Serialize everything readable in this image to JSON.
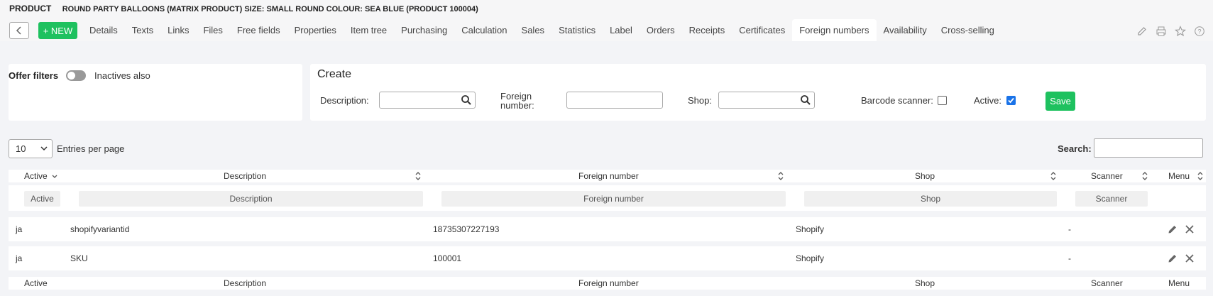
{
  "header": {
    "label": "PRODUCT",
    "product_name": "ROUND PARTY BALLOONS (MATRIX PRODUCT) SIZE: SMALL ROUND COLOUR: SEA BLUE (PRODUCT 100004)"
  },
  "toolbar": {
    "new_label": "+ NEW",
    "tabs": [
      "Details",
      "Texts",
      "Links",
      "Files",
      "Free fields",
      "Properties",
      "Item tree",
      "Purchasing",
      "Calculation",
      "Sales",
      "Statistics",
      "Label",
      "Orders",
      "Receipts",
      "Certificates",
      "Foreign numbers",
      "Availability",
      "Cross-selling"
    ],
    "active_tab": "Foreign numbers"
  },
  "offer_filters": {
    "label": "Offer filters",
    "inactives_label": "Inactives also",
    "inactives_on": false
  },
  "create": {
    "title": "Create",
    "description_label": "Description:",
    "foreign_number_label_1": "Foreign",
    "foreign_number_label_2": "number:",
    "shop_label": "Shop:",
    "barcode_label": "Barcode scanner:",
    "barcode_checked": false,
    "active_label": "Active:",
    "active_checked": true,
    "save_label": "Save"
  },
  "list_controls": {
    "per_page_value": "10",
    "per_page_label": "Entries per page",
    "search_label": "Search:"
  },
  "table": {
    "columns": [
      "Active",
      "Description",
      "Foreign number",
      "Shop",
      "Scanner",
      "Menu"
    ],
    "filters": [
      "Active",
      "Description",
      "Foreign number",
      "Shop",
      "Scanner"
    ],
    "rows": [
      {
        "active": "ja",
        "description": "shopifyvariantid",
        "foreign_number": "18735307227193",
        "shop": "Shopify",
        "scanner": "-"
      },
      {
        "active": "ja",
        "description": "SKU",
        "foreign_number": "100001",
        "shop": "Shopify",
        "scanner": "-"
      }
    ]
  },
  "colors": {
    "accent_green": "#1ec15f",
    "checkbox_blue": "#1a73e8",
    "background": "#f3f4f7"
  }
}
